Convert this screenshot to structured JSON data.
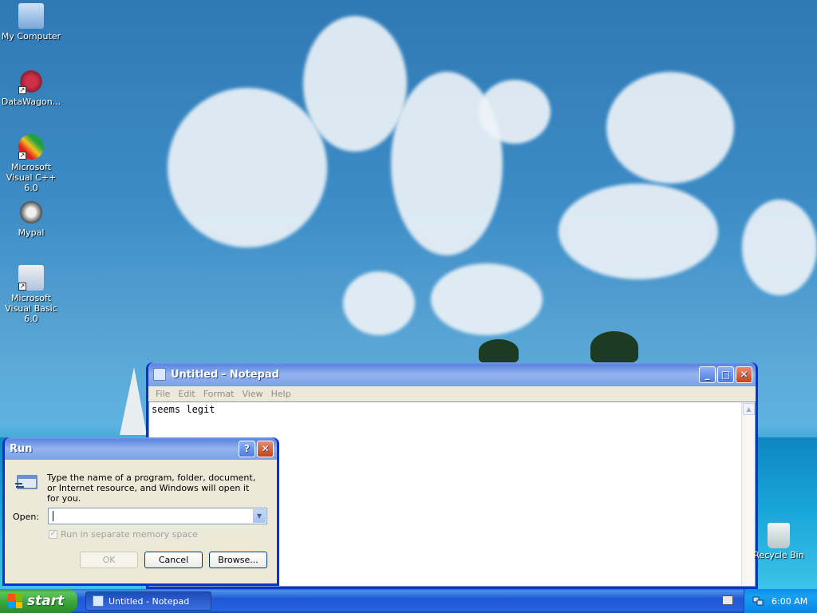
{
  "desktop": {
    "icons": [
      {
        "label": "My Computer",
        "icon": "my-computer-icon"
      },
      {
        "label": "DataWagon...",
        "icon": "datawagon-icon"
      },
      {
        "label": "Microsoft Visual C++ 6.0",
        "icon": "visual-cpp-icon"
      },
      {
        "label": "Mypal",
        "icon": "mypal-icon"
      },
      {
        "label": "Microsoft Visual Basic 6.0",
        "icon": "visual-basic-icon"
      }
    ],
    "recycle_bin": {
      "label": "Recycle Bin",
      "icon": "recycle-bin-icon"
    }
  },
  "notepad": {
    "title": "Untitled - Notepad",
    "menu": [
      "File",
      "Edit",
      "Format",
      "View",
      "Help"
    ],
    "content": "seems legit",
    "buttons": {
      "minimize": "_",
      "maximize": "□",
      "close": "✕"
    }
  },
  "run_dialog": {
    "title": "Run",
    "help_button": "?",
    "close_button": "✕",
    "description": "Type the name of a program, folder, document, or Internet resource, and Windows will open it for you.",
    "open_label": "Open:",
    "open_value": "",
    "checkbox_label": "Run in separate memory space",
    "checkbox_checked": true,
    "checkbox_enabled": false,
    "buttons": {
      "ok": "OK",
      "cancel": "Cancel",
      "browse": "Browse..."
    }
  },
  "taskbar": {
    "start_label": "start",
    "tasks": [
      {
        "label": "Untitled - Notepad"
      }
    ],
    "clock": "6:00 AM"
  },
  "colors": {
    "titlebar_blue": "#0831d9",
    "start_green": "#37a237",
    "dialog_bg": "#ece9d8"
  }
}
